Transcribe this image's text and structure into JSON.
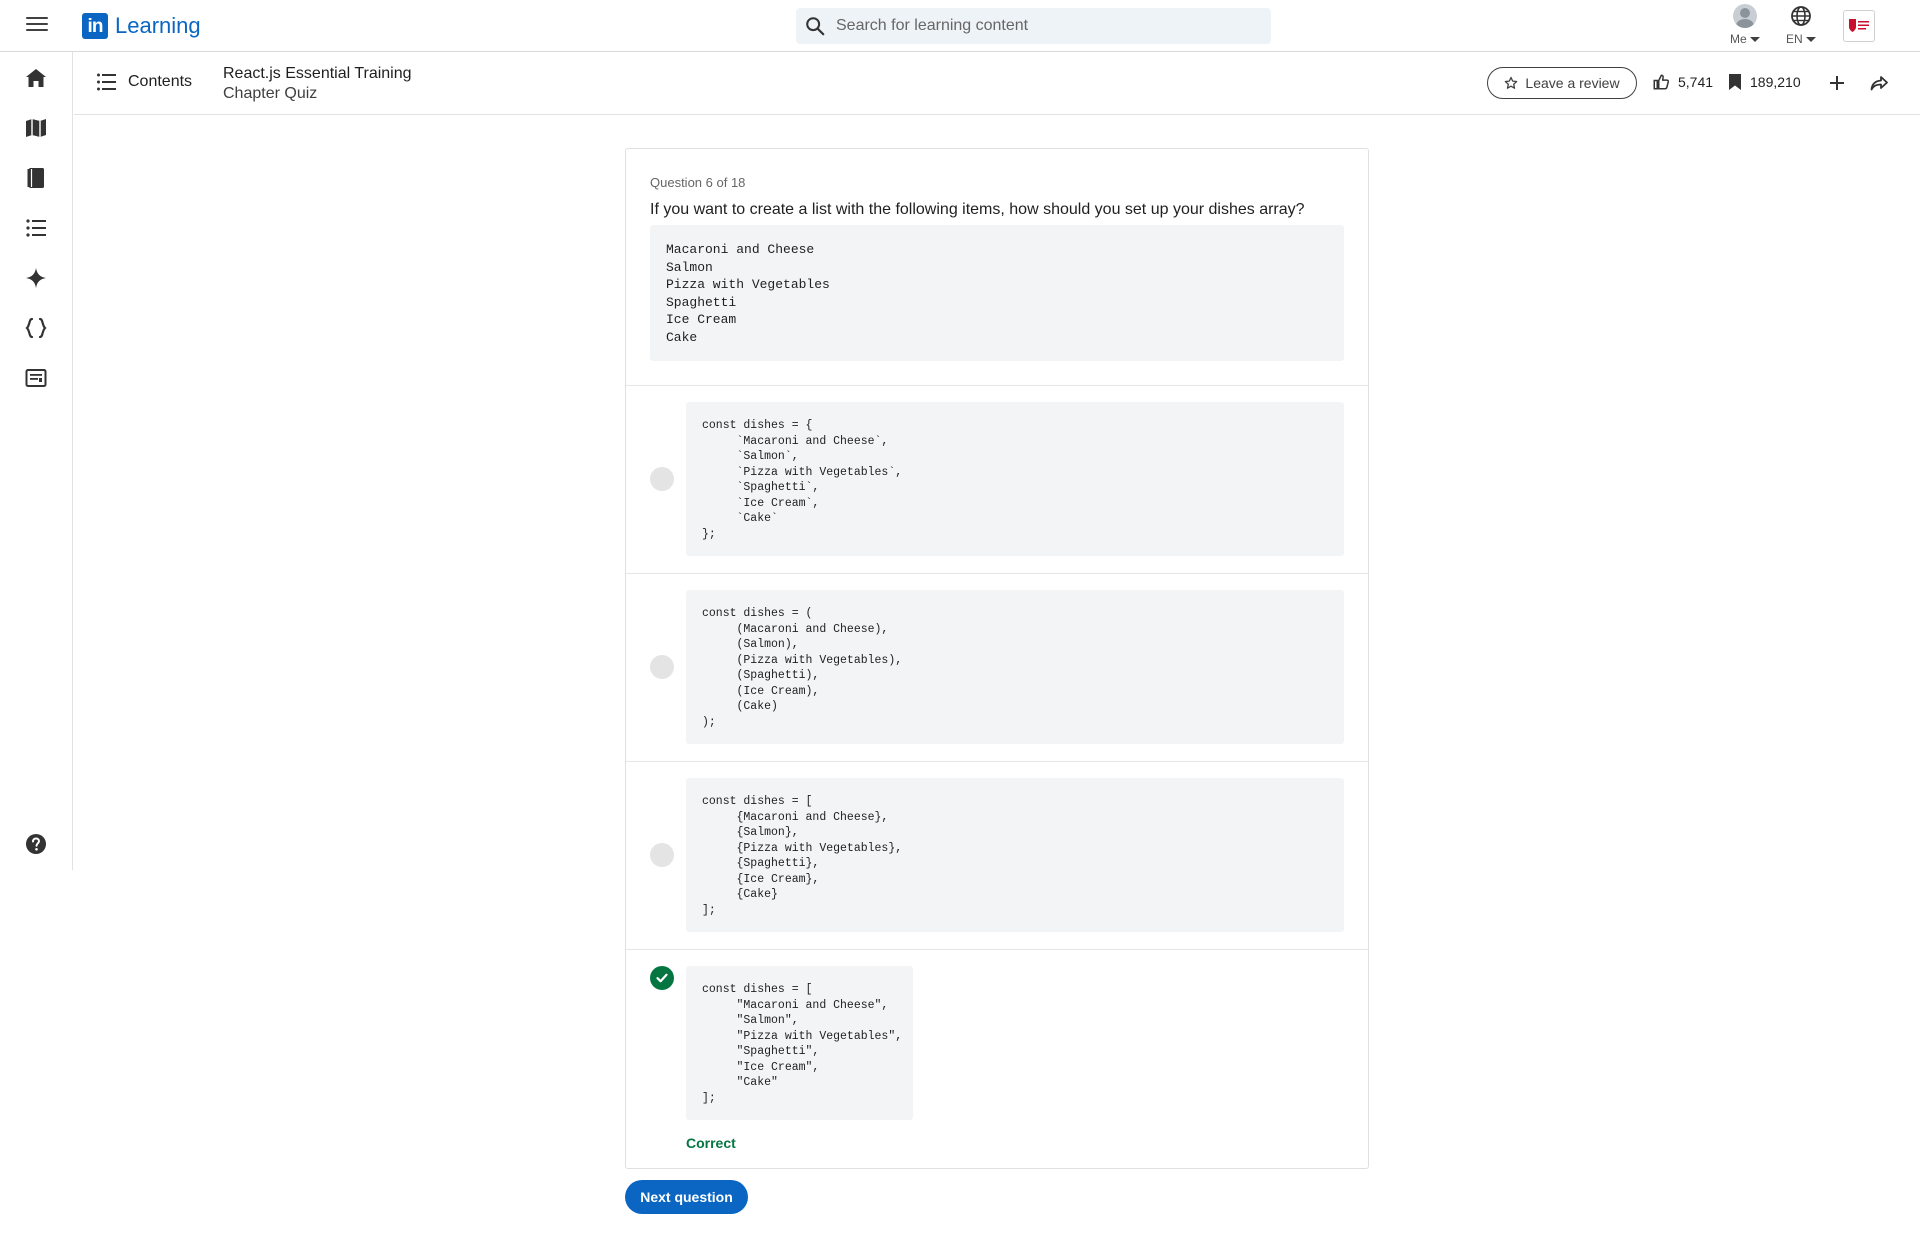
{
  "topbar": {
    "brand_logo": "in",
    "brand_name": "Learning",
    "search_placeholder": "Search for learning content",
    "me_label": "Me",
    "lang_label": "EN"
  },
  "course": {
    "contents_label": "Contents",
    "title": "React.js Essential Training",
    "subtitle": "Chapter Quiz",
    "review_label": "Leave a review",
    "likes": "5,741",
    "saves": "189,210"
  },
  "quiz": {
    "count": "Question 6 of 18",
    "question": "If you want to create a list with the following items, how should you set up your dishes array?",
    "items_code": "Macaroni and Cheese\nSalmon\nPizza with Vegetables\nSpaghetti\nIce Cream\nCake",
    "options": [
      {
        "code": "const dishes = {\n     `Macaroni and Cheese`,\n     `Salmon`,\n     `Pizza with Vegetables`,\n     `Spaghetti`,\n     `Ice Cream`,\n     `Cake`\n};",
        "state": "unselected"
      },
      {
        "code": "const dishes = (\n     (Macaroni and Cheese),\n     (Salmon),\n     (Pizza with Vegetables),\n     (Spaghetti),\n     (Ice Cream),\n     (Cake)\n);",
        "state": "unselected"
      },
      {
        "code": "const dishes = [\n     {Macaroni and Cheese},\n     {Salmon},\n     {Pizza with Vegetables},\n     {Spaghetti},\n     {Ice Cream},\n     {Cake}\n];",
        "state": "unselected"
      },
      {
        "code": "const dishes = [\n     \"Macaroni and Cheese\",\n     \"Salmon\",\n     \"Pizza with Vegetables\",\n     \"Spaghetti\",\n     \"Ice Cream\",\n     \"Cake\"\n];",
        "state": "correct"
      }
    ],
    "correct_label": "Correct",
    "next_label": "Next question"
  },
  "colors": {
    "brand": "#0a66c2",
    "correct": "#057642",
    "code_bg": "#f3f4f6"
  },
  "icons": {
    "rail": [
      "home-icon",
      "map-icon",
      "book-icon",
      "list-icon",
      "sparkle-icon",
      "code-braces-icon",
      "certificate-icon",
      "help-icon"
    ]
  }
}
